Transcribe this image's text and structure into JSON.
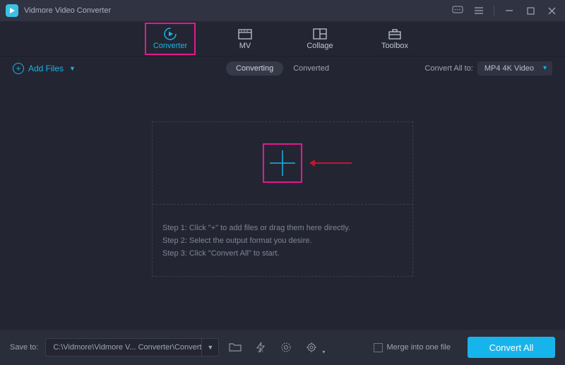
{
  "app": {
    "title": "Vidmore Video Converter"
  },
  "tabs": {
    "converter": "Converter",
    "mv": "MV",
    "collage": "Collage",
    "toolbox": "Toolbox"
  },
  "toolbar": {
    "add_files": "Add Files",
    "converting": "Converting",
    "converted": "Converted",
    "convert_all_to": "Convert All to:",
    "format": "MP4 4K Video"
  },
  "instructions": {
    "step1": "Step 1: Click \"+\" to add files or drag them here directly.",
    "step2": "Step 2: Select the output format you desire.",
    "step3": "Step 3: Click \"Convert All\" to start."
  },
  "footer": {
    "save_to": "Save to:",
    "path": "C:\\Vidmore\\Vidmore V... Converter\\Converted",
    "merge": "Merge into one file",
    "convert_all": "Convert All"
  }
}
